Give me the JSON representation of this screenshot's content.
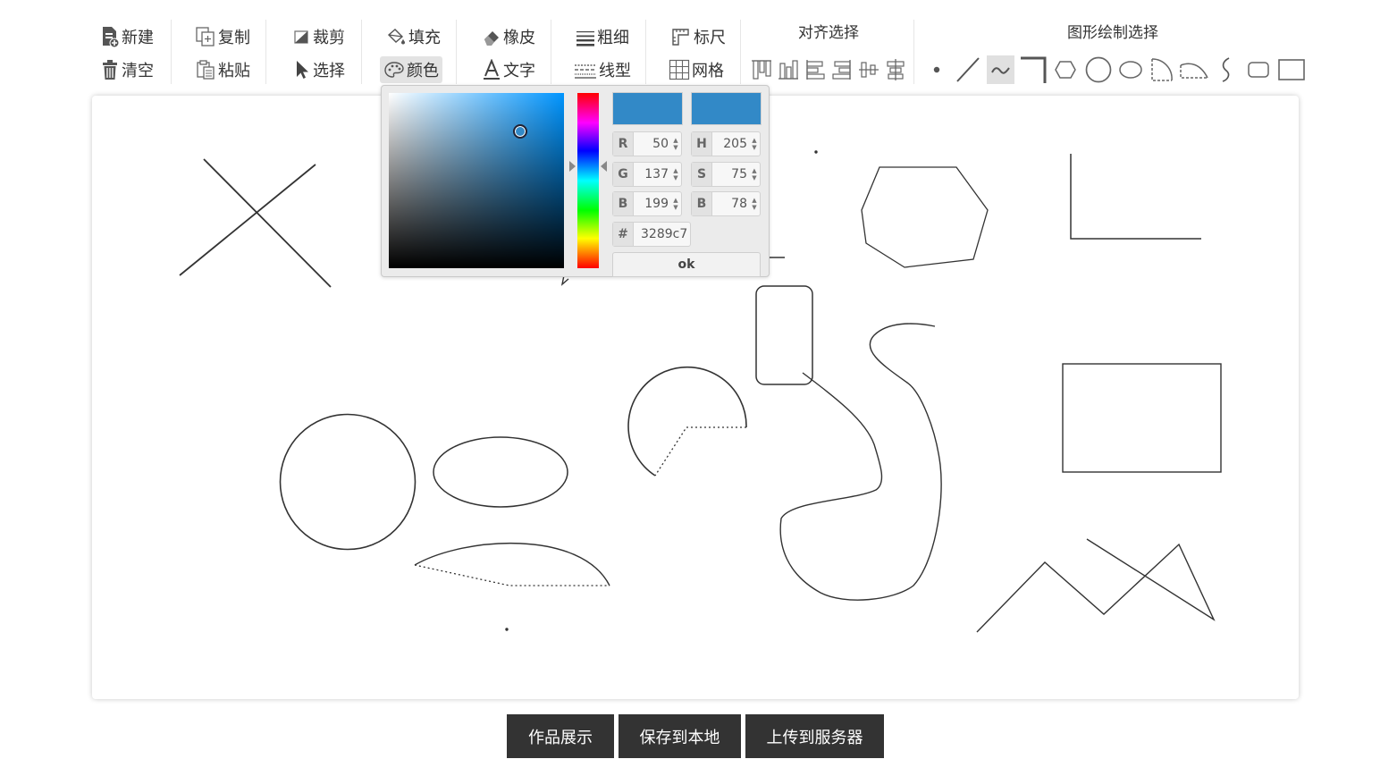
{
  "toolbar": {
    "new": "新建",
    "clear": "清空",
    "copy": "复制",
    "paste": "粘贴",
    "crop": "裁剪",
    "select": "选择",
    "fill": "填充",
    "color": "颜色",
    "eraser": "橡皮",
    "text": "文字",
    "thickness": "粗细",
    "linetype": "线型",
    "ruler": "标尺",
    "grid": "网格"
  },
  "align_group": {
    "title": "对齐选择",
    "icons": [
      "align-top-icon",
      "align-bottom-icon",
      "align-left-icon",
      "align-right-icon",
      "align-center-vertical-icon",
      "align-center-horizontal-icon"
    ]
  },
  "shape_group": {
    "title": "图形绘制选择",
    "icons": [
      "point-icon",
      "line-icon",
      "freehand-icon",
      "polyline-icon",
      "polygon-icon",
      "circle-icon",
      "ellipse-icon",
      "sector-icon",
      "arc-icon",
      "curve-icon",
      "rounded-rect-icon",
      "rectangle-icon"
    ],
    "active": "freehand-icon"
  },
  "color_picker": {
    "current_color": "#3289c7",
    "previous_color": "#3289c7",
    "r": "50",
    "g": "137",
    "b": "199",
    "h": "205",
    "s": "75",
    "br": "78",
    "hex": "3289c7",
    "ok": "ok",
    "labels": {
      "r": "R",
      "g": "G",
      "b": "B",
      "h": "H",
      "s": "S",
      "br": "B",
      "hex": "#"
    },
    "hue_base": "#0095ff",
    "saturation": 0.75,
    "brightness": 0.78
  },
  "footer": {
    "gallery": "作品展示",
    "save_local": "保存到本地",
    "upload_server": "上传到服务器"
  },
  "colors": {
    "button_dark": "#333333",
    "active_tool_bg": "#e0e0e0",
    "stroke": "#333333"
  }
}
